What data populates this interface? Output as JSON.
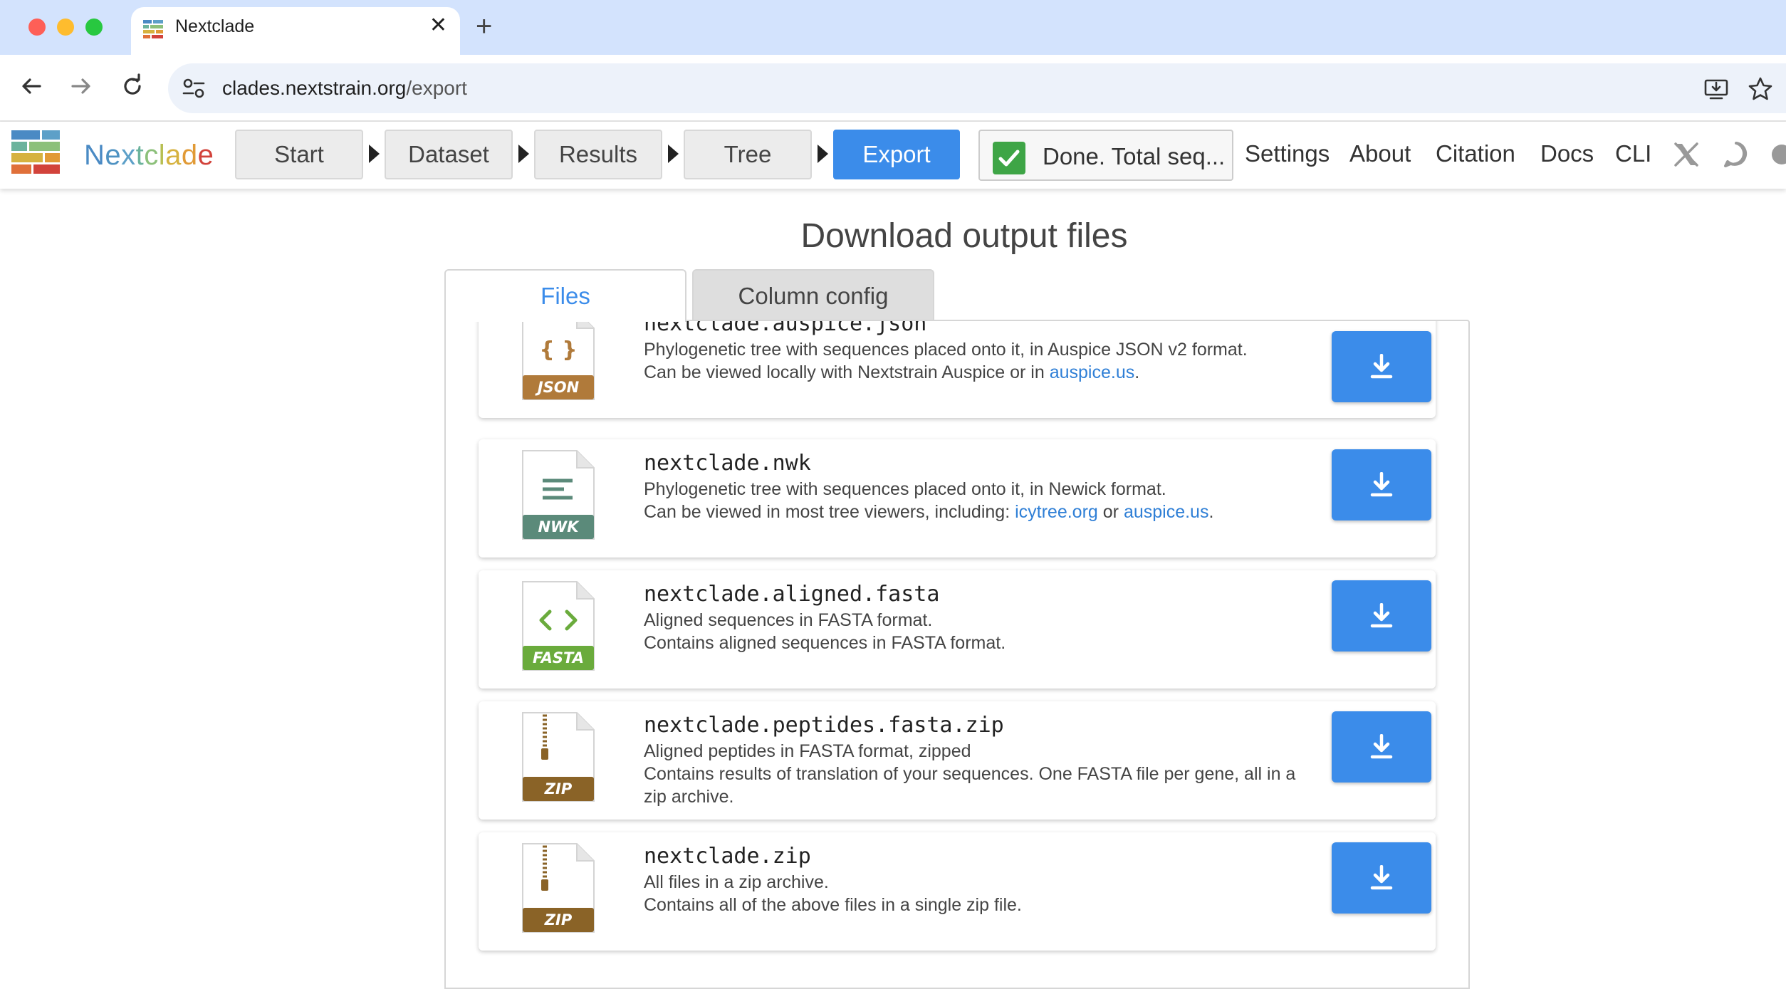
{
  "browser": {
    "tab_title": "Nextclade",
    "url_host": "clades.nextstrain.org",
    "url_path": "/export"
  },
  "navbar": {
    "brand": "Nextclade",
    "steps": [
      "Start",
      "Dataset",
      "Results",
      "Tree",
      "Export"
    ],
    "active_step": "Export",
    "status_text": "Done. Total seq...",
    "links": [
      "Settings",
      "About",
      "Citation",
      "Docs",
      "CLI"
    ]
  },
  "main": {
    "title": "Download output files",
    "tabs": [
      "Files",
      "Column config"
    ],
    "active_tab": "Files",
    "files": [
      {
        "name": "nextclade.auspice.json",
        "badge": "JSON",
        "badge_color": "#b07a3a",
        "line1": "Phylogenetic tree with sequences placed onto it, in Auspice JSON v2 format.",
        "line2_prefix": "Can be viewed locally with Nextstrain Auspice or in ",
        "link1": "auspice.us",
        "line2_mid": "",
        "link2": "",
        "line2_suffix": "."
      },
      {
        "name": "nextclade.nwk",
        "badge": "NWK",
        "badge_color": "#5b8a7a",
        "line1": "Phylogenetic tree with sequences placed onto it, in Newick format.",
        "line2_prefix": "Can be viewed in most tree viewers, including: ",
        "link1": "icytree.org",
        "line2_mid": " or ",
        "link2": "auspice.us",
        "line2_suffix": "."
      },
      {
        "name": "nextclade.aligned.fasta",
        "badge": "FASTA",
        "badge_color": "#6aab3c",
        "line1": "Aligned sequences in FASTA format.",
        "line2_prefix": "Contains aligned sequences in FASTA format.",
        "link1": "",
        "line2_mid": "",
        "link2": "",
        "line2_suffix": ""
      },
      {
        "name": "nextclade.peptides.fasta.zip",
        "badge": "ZIP",
        "badge_color": "#8a6327",
        "line1": "Aligned peptides in FASTA format, zipped",
        "line2_prefix": "Contains results of translation of your sequences. One FASTA file per gene, all in a zip archive.",
        "link1": "",
        "line2_mid": "",
        "link2": "",
        "line2_suffix": ""
      },
      {
        "name": "nextclade.zip",
        "badge": "ZIP",
        "badge_color": "#8a6327",
        "line1": "All files in a zip archive.",
        "line2_prefix": "Contains all of the above files in a single zip file.",
        "link1": "",
        "line2_mid": "",
        "link2": "",
        "line2_suffix": ""
      }
    ]
  },
  "colors": {
    "accent": "#3b8cea",
    "link": "#2f7fd6",
    "status_ok": "#3ea546"
  },
  "icons": [
    "back-icon",
    "forward-icon",
    "reload-icon",
    "site-info-icon",
    "install-app-icon",
    "bookmark-star-icon",
    "x-twitter-icon",
    "discourse-icon",
    "download-icon",
    "json-file-icon",
    "nwk-file-icon",
    "fasta-file-icon",
    "zip-file-icon"
  ]
}
